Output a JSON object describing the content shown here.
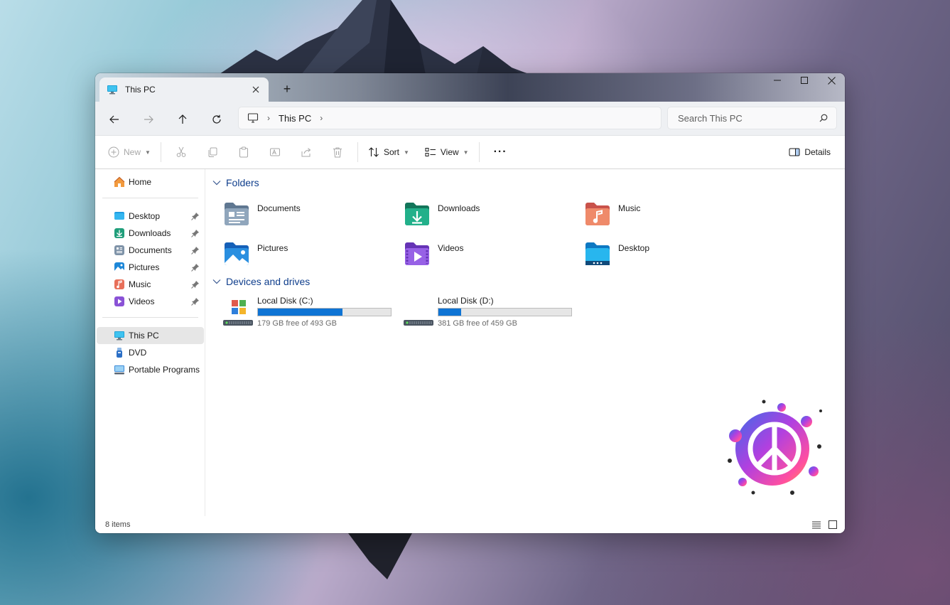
{
  "window": {
    "tab_title": "This PC",
    "new_tab": "+"
  },
  "nav": {
    "breadcrumb": [
      "This PC"
    ],
    "search_placeholder": "Search This PC"
  },
  "commandbar": {
    "new_label": "New",
    "sort_label": "Sort",
    "view_label": "View",
    "more_label": "···",
    "details_label": "Details"
  },
  "sidebar": {
    "home": "Home",
    "quick_access": [
      {
        "label": "Desktop",
        "icon": "desktop-folder-icon"
      },
      {
        "label": "Downloads",
        "icon": "downloads-folder-icon"
      },
      {
        "label": "Documents",
        "icon": "documents-folder-icon"
      },
      {
        "label": "Pictures",
        "icon": "pictures-folder-icon"
      },
      {
        "label": "Music",
        "icon": "music-folder-icon"
      },
      {
        "label": "Videos",
        "icon": "videos-folder-icon"
      }
    ],
    "devices": [
      {
        "label": "This PC",
        "icon": "this-pc-icon",
        "selected": true
      },
      {
        "label": "DVD",
        "icon": "dvd-drive-icon"
      },
      {
        "label": "Portable Programs",
        "icon": "network-drive-icon"
      }
    ]
  },
  "main": {
    "folders_header": "Folders",
    "folders": [
      {
        "label": "Documents",
        "icon": "documents-folder-icon"
      },
      {
        "label": "Downloads",
        "icon": "downloads-folder-icon"
      },
      {
        "label": "Music",
        "icon": "music-folder-icon"
      },
      {
        "label": "Pictures",
        "icon": "pictures-folder-icon"
      },
      {
        "label": "Videos",
        "icon": "videos-folder-icon"
      },
      {
        "label": "Desktop",
        "icon": "desktop-folder-icon"
      }
    ],
    "drives_header": "Devices and drives",
    "drives": [
      {
        "name": "Local Disk (C:)",
        "free_text": "179 GB free of 493 GB",
        "used_fraction": 0.637
      },
      {
        "name": "Local Disk (D:)",
        "free_text": "381 GB free of 459 GB",
        "used_fraction": 0.17
      }
    ]
  },
  "status": {
    "items": "8 items"
  },
  "colors": {
    "accent": "#0f74d4",
    "header_text": "#0f3e8c"
  }
}
